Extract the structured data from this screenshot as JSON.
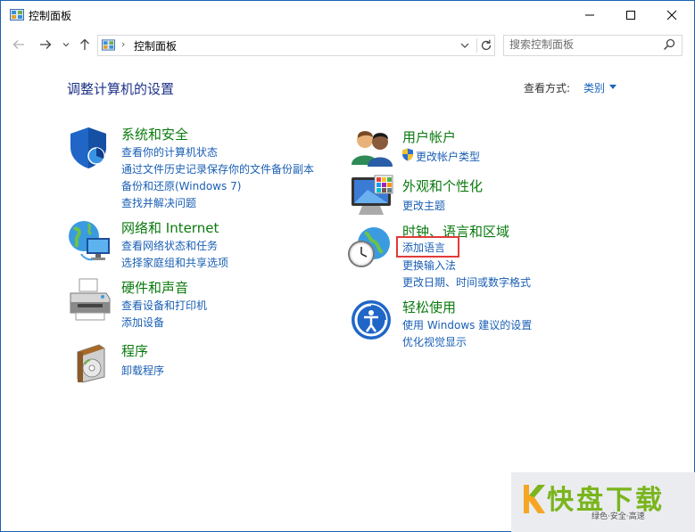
{
  "window": {
    "title": "控制面板",
    "icon": "control-panel-icon",
    "minimize_icon": "minimize-icon",
    "maximize_icon": "maximize-icon",
    "close_icon": "close-icon"
  },
  "nav": {
    "back_icon": "back-arrow-icon",
    "forward_icon": "forward-arrow-icon",
    "recent_icon": "chevron-down-icon",
    "up_icon": "up-arrow-icon",
    "address_separator": "›",
    "address_path": "控制面板",
    "search_placeholder": "搜索控制面板"
  },
  "content": {
    "heading": "调整计算机的设置",
    "view_by_label": "查看方式:",
    "view_by_value": "类别"
  },
  "categories": [
    {
      "title": "系统和安全",
      "icon": "shield-icon",
      "links": [
        "查看你的计算机状态",
        "通过文件历史记录保存你的文件备份副本",
        "备份和还原(Windows 7)",
        "查找并解决问题"
      ]
    },
    {
      "title": "网络和 Internet",
      "icon": "network-globe-icon",
      "links": [
        "查看网络状态和任务",
        "选择家庭组和共享选项"
      ]
    },
    {
      "title": "硬件和声音",
      "icon": "printer-icon",
      "links": [
        "查看设备和打印机",
        "添加设备"
      ]
    },
    {
      "title": "程序",
      "icon": "programs-disc-icon",
      "links": [
        "卸载程序"
      ]
    },
    {
      "title": "用户帐户",
      "icon": "users-icon",
      "links": [
        "更改帐户类型"
      ]
    },
    {
      "title": "外观和个性化",
      "icon": "monitor-palette-icon",
      "links": [
        "更改主题"
      ]
    },
    {
      "title": "时钟、语言和区域",
      "icon": "clock-globe-icon",
      "links": [
        "添加语言",
        "更换输入法",
        "更改日期、时间或数字格式"
      ]
    },
    {
      "title": "轻松使用",
      "icon": "ease-of-access-icon",
      "links": [
        "使用 Windows 建议的设置",
        "优化视觉显示"
      ]
    }
  ],
  "colors": {
    "category_title": "#0a7a0e",
    "link": "#1a5fb4",
    "heading": "#1e3287",
    "highlight": "#e23a3a"
  },
  "watermark": {
    "main": "快盘下载",
    "sub": "绿色·安全·高速"
  }
}
